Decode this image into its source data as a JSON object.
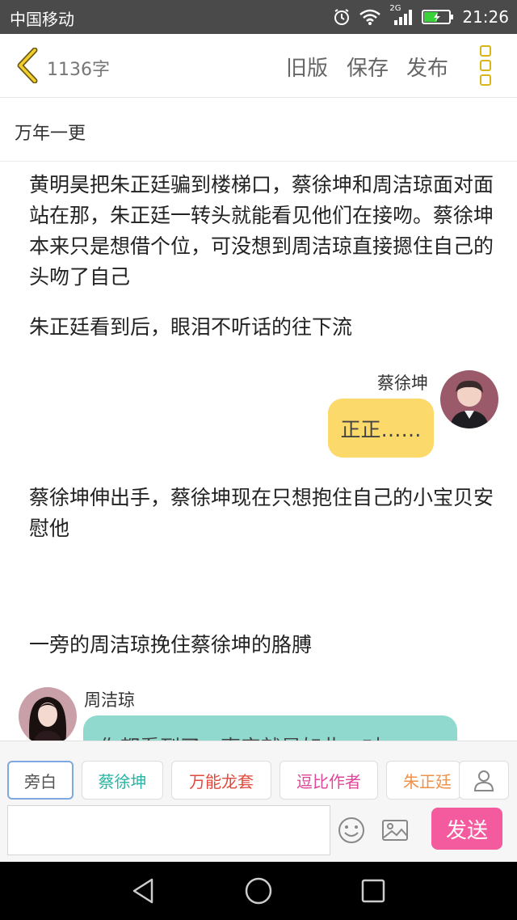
{
  "status_bar": {
    "carrier": "中国移动",
    "network": "2G",
    "time": "21:26"
  },
  "header": {
    "word_count": "1136字",
    "old_version_label": "旧版",
    "save_label": "保存",
    "publish_label": "发布"
  },
  "story": {
    "title": "万年一更"
  },
  "content": {
    "narration_1": "黄明昊把朱正廷骗到楼梯口，蔡徐坤和周洁琼面对面站在那，朱正廷一转头就能看见他们在接吻。蔡徐坤本来只是想借个位，可没想到周洁琼直接摁住自己的头吻了自己",
    "narration_2": "朱正廷看到后，眼泪不听话的往下流",
    "message_1": {
      "speaker": "蔡徐坤",
      "text": "正正……"
    },
    "narration_3": "蔡徐坤伸出手，蔡徐坤现在只想抱住自己的小宝贝安慰他",
    "narration_4": "一旁的周洁琼挽住蔡徐坤的胳膊",
    "message_2": {
      "speaker": "周洁琼",
      "text": "你都看到了，事实就是如此，对"
    }
  },
  "roles": [
    {
      "label": "旁白",
      "color": "#555555"
    },
    {
      "label": "蔡徐坤",
      "color": "#2bb3a3"
    },
    {
      "label": "万能龙套",
      "color": "#e04a3c"
    },
    {
      "label": "逗比作者",
      "color": "#e0479a"
    },
    {
      "label": "朱正廷",
      "color": "#f0914a"
    }
  ],
  "composer": {
    "input_value": "",
    "send_label": "发送"
  },
  "colors": {
    "accent_yellow": "#d9b516",
    "bubble_yellow": "#fcd96b",
    "bubble_teal": "#8fd9cf",
    "send_pink": "#f45b9e"
  }
}
